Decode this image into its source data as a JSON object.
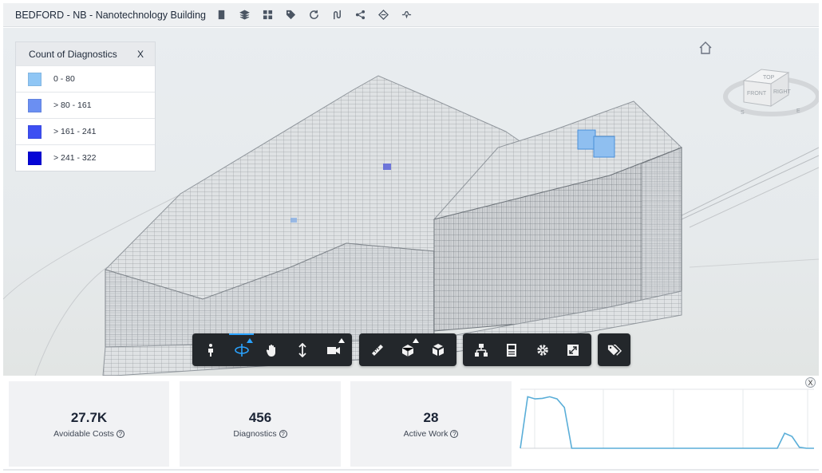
{
  "header": {
    "title": "BEDFORD - NB - Nanotechnology Building",
    "tools": [
      "building-icon",
      "layers-icon",
      "grid-icon",
      "tag-icon",
      "refresh-icon",
      "route-icon",
      "share-icon",
      "scan-icon",
      "flow-icon"
    ]
  },
  "legend": {
    "title": "Count of Diagnostics",
    "close": "X",
    "items": [
      {
        "label": "0 - 80",
        "color": "#8fc6f5"
      },
      {
        "label": "> 80 - 161",
        "color": "#6b8ff2"
      },
      {
        "label": "> 161 - 241",
        "color": "#3d4ff2"
      },
      {
        "label": "> 241 - 322",
        "color": "#0505d6"
      }
    ]
  },
  "viewcube": {
    "top": "TOP",
    "front": "FRONT",
    "right": "RIGHT",
    "compass_s": "S",
    "compass_e": "E"
  },
  "toolbar": {
    "groups": [
      [
        "walk-icon",
        "orbit-icon",
        "pan-icon",
        "dolly-icon",
        "camera-icon"
      ],
      [
        "measure-icon",
        "section-icon",
        "explode-icon"
      ],
      [
        "model-browser-icon",
        "properties-icon",
        "settings-icon",
        "fullscreen-icon"
      ],
      [
        "tags-icon"
      ]
    ],
    "active": "orbit-icon"
  },
  "metrics": [
    {
      "value": "27.7K",
      "label": "Avoidable Costs"
    },
    {
      "value": "456",
      "label": "Diagnostics"
    },
    {
      "value": "28",
      "label": "Active Work"
    }
  ],
  "help_glyph": "?",
  "bottom_close": "X",
  "chart_data": {
    "type": "line",
    "title": "",
    "xlabel": "",
    "ylabel": "",
    "color": "#5aaed8",
    "x": [
      0,
      1,
      2,
      3,
      4,
      5,
      6,
      7,
      8,
      9,
      10,
      11,
      12,
      13,
      14,
      15,
      16,
      17,
      18,
      19,
      20,
      21,
      22,
      23,
      24,
      25,
      26,
      27,
      28,
      29,
      30,
      31,
      32,
      33,
      34,
      35,
      36,
      37,
      38,
      39,
      40
    ],
    "values": [
      0,
      0.96,
      0.92,
      0.93,
      0.96,
      0.92,
      0.76,
      0,
      0,
      0,
      0,
      0,
      0,
      0,
      0,
      0,
      0,
      0,
      0,
      0,
      0,
      0,
      0,
      0,
      0,
      0,
      0,
      0,
      0,
      0,
      0,
      0,
      0,
      0,
      0,
      0,
      0.28,
      0.22,
      0.02,
      0,
      0
    ],
    "ylim": [
      0,
      1.1
    ],
    "grid": true
  }
}
